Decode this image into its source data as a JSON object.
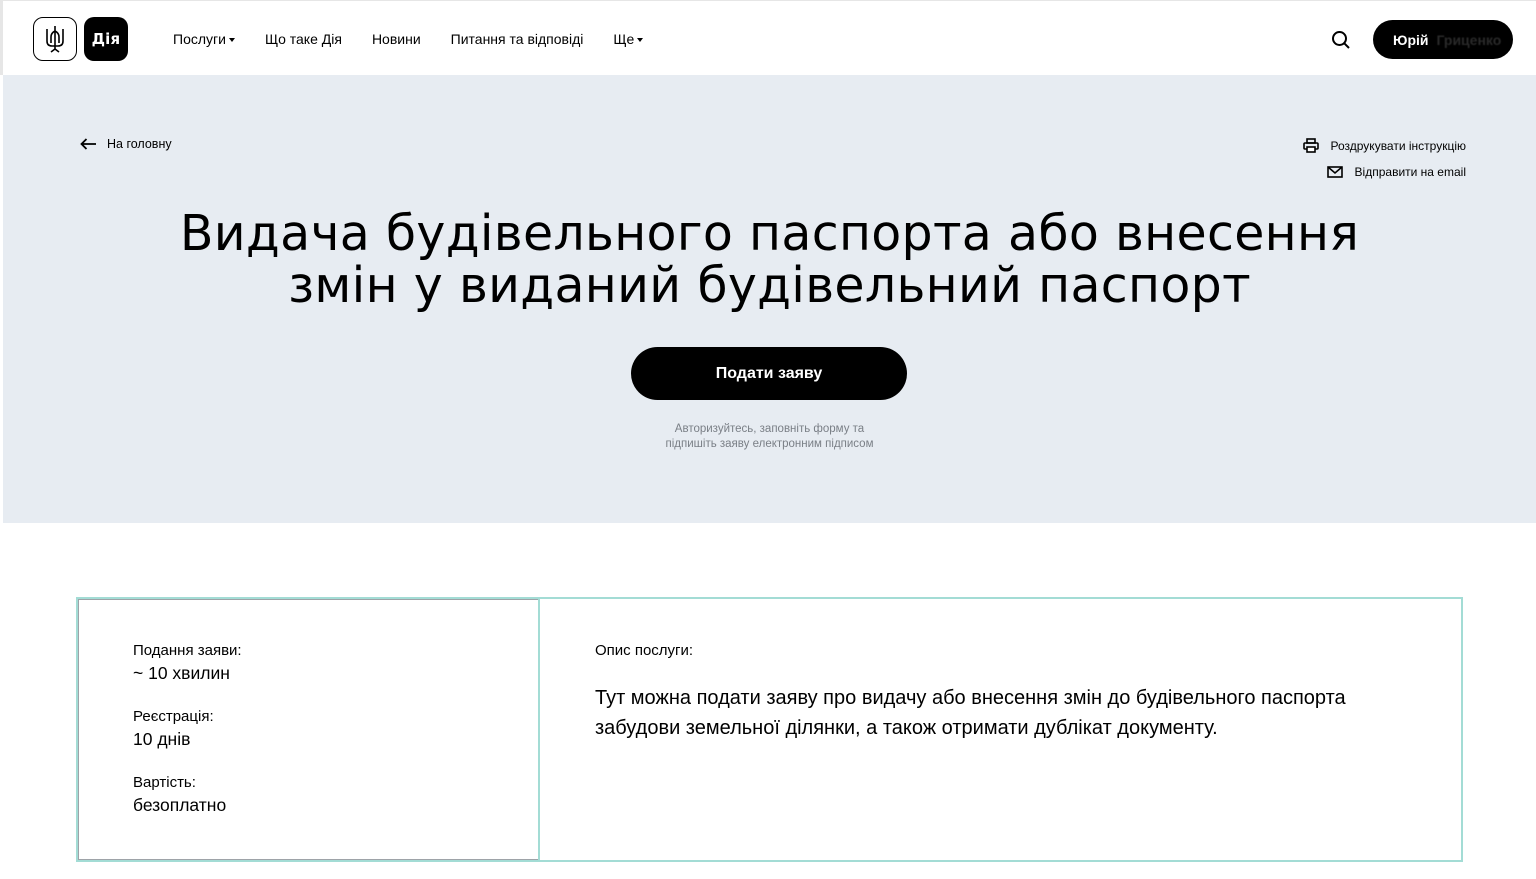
{
  "header": {
    "logo_text": "Дія",
    "nav": [
      {
        "label": "Послуги",
        "has_caret": true
      },
      {
        "label": "Що таке Дія",
        "has_caret": false
      },
      {
        "label": "Новини",
        "has_caret": false
      },
      {
        "label": "Питання та відповіді",
        "has_caret": false
      },
      {
        "label": "Ще",
        "has_caret": true
      }
    ],
    "search_icon": "search-icon",
    "user": {
      "first_name": "Юрій",
      "last_name": "Гриценко"
    }
  },
  "hero": {
    "back_label": "На головну",
    "print_label": "Роздрукувати інструкцію",
    "email_label": "Відправити на email",
    "title_line1": "Видача будівельного паспорта або внесення",
    "title_line2": "змін у виданий будівельний паспорт",
    "apply_label": "Подати заяву",
    "hint_line1": "Авторизуйтесь, заповніть форму та",
    "hint_line2": "підпишіть заяву електронним підписом"
  },
  "info": {
    "submission_label": "Подання заяви:",
    "submission_value": "~ 10 хвилин",
    "registration_label": "Реєстрація:",
    "registration_value": "10 днів",
    "cost_label": "Вартість:",
    "cost_value": "безоплатно",
    "description_label": "Опис послуги:",
    "description_text": "Тут можна подати заяву про видачу або внесення змін до будівельного паспорта забудови земельної ділянки, а також отримати дублікат документу."
  },
  "colors": {
    "hero_bg": "#e7ecf2",
    "accent_border": "#a3dcd5",
    "button_bg": "#000000"
  }
}
